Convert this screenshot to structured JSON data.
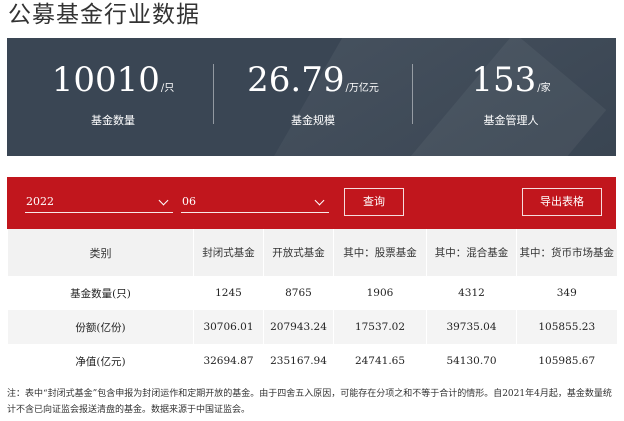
{
  "page_title": "公募基金行业数据",
  "stats": [
    {
      "value": "10010",
      "unit": "/只",
      "label": "基金数量"
    },
    {
      "value": "26.79",
      "unit": "/万亿元",
      "label": "基金规模"
    },
    {
      "value": "153",
      "unit": "/家",
      "label": "基金管理人"
    }
  ],
  "filters": {
    "year": "2022",
    "month": "06",
    "query_label": "查询",
    "export_label": "导出表格"
  },
  "table": {
    "headers": [
      "类别",
      "封闭式基金",
      "开放式基金",
      "其中：股票基金",
      "其中：混合基金",
      "其中：货币市场基金"
    ],
    "rows": [
      {
        "label": "基金数量(只)",
        "values": [
          "1245",
          "8765",
          "1906",
          "4312",
          "349"
        ]
      },
      {
        "label": "份额(亿份)",
        "values": [
          "30706.01",
          "207943.24",
          "17537.02",
          "39735.04",
          "105855.23"
        ]
      },
      {
        "label": "净值(亿元)",
        "values": [
          "32694.87",
          "235167.94",
          "24741.65",
          "54130.70",
          "105985.67"
        ]
      }
    ]
  },
  "note": "注：表中“封闭式基金”包含申报为封闭运作和定期开放的基金。由于四舍五入原因，可能存在分项之和不等于合计的情形。自2021年4月起，基金数量统计不含已向证监会报送清盘的基金。数据来源于中国证监会。",
  "colors": {
    "banner": "#3a4654",
    "toolbar": "#c1161d"
  }
}
